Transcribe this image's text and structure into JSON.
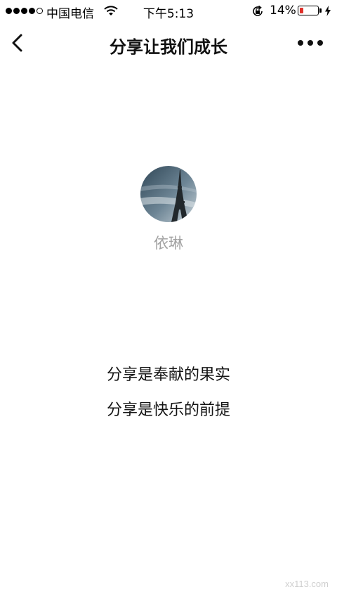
{
  "status_bar": {
    "carrier": "中国电信",
    "time": "下午5:13",
    "battery_percent": "14%",
    "battery_level": 0.14,
    "battery_color": "#e0302a"
  },
  "nav": {
    "title": "分享让我们成长"
  },
  "profile": {
    "name": "依琳"
  },
  "content": {
    "lines": [
      "分享是奉献的果实",
      "分享是快乐的前提"
    ]
  },
  "watermark": "xx113.com"
}
